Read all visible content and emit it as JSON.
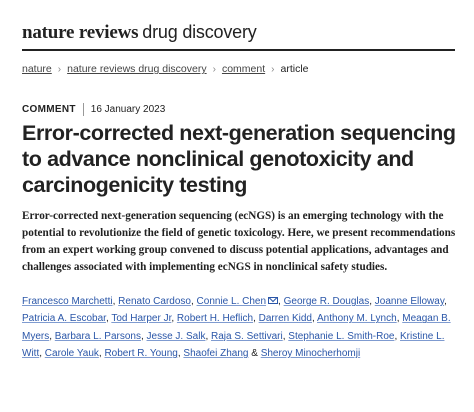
{
  "masthead": {
    "bold": "nature reviews",
    "light": "drug discovery"
  },
  "breadcrumb": {
    "items": [
      "nature",
      "nature reviews drug discovery",
      "comment"
    ],
    "current": "article",
    "separator": "›"
  },
  "meta": {
    "article_type": "COMMENT",
    "date": "16 January 2023"
  },
  "article": {
    "title": "Error-corrected next-generation sequencing to advance nonclinical genotoxicity and carcinogenicity testing",
    "standfirst": "Error-corrected next-generation sequencing (ecNGS) is an emerging technology with the potential to revolutionize the field of genetic toxicology. Here, we present recommendations from an expert working group convened to discuss potential applications, advantages and challenges associated with implementing ecNGS in nonclinical safety studies."
  },
  "authors": {
    "list": [
      "Francesco Marchetti",
      "Renato Cardoso",
      "Connie L. Chen",
      "George R. Douglas",
      "Joanne Elloway",
      "Patricia A. Escobar",
      "Tod Harper Jr",
      "Robert H. Heflich",
      "Darren Kidd",
      "Anthony M. Lynch",
      "Meagan B. Myers",
      "Barbara L. Parsons",
      "Jesse J. Salk",
      "Raja S. Settivari",
      "Stephanie L. Smith-Roe",
      "Kristine L. Witt",
      "Carole Yauk",
      "Robert R. Young",
      "Shaofei Zhang",
      "Sheroy Minocherhomji"
    ],
    "corresponding_author_icon": "email-icon",
    "last_joiner": "&",
    "joiner": ","
  },
  "colors": {
    "link": "#2a56a8",
    "text": "#222222",
    "rule": "#222222"
  }
}
